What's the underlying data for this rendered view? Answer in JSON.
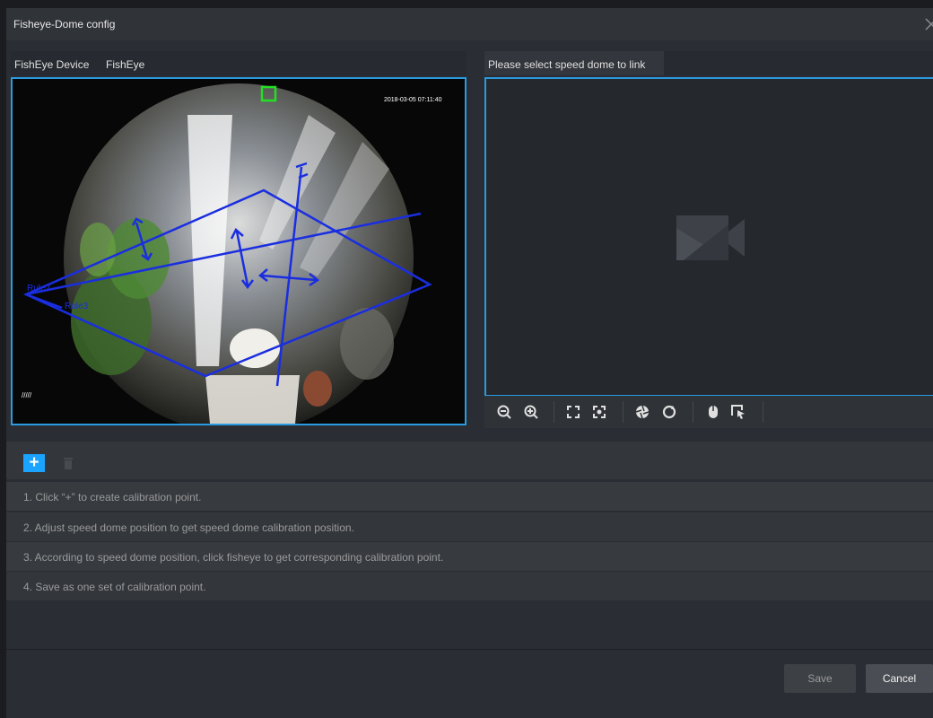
{
  "dialog": {
    "title": "Fisheye-Dome config"
  },
  "left_panel": {
    "device_label": "FishEye Device",
    "channel_label": "FishEye",
    "timestamp": "2018-03-05 07:11:40",
    "corner_text": "/////",
    "region_labels": [
      "Rule2",
      "Rule3"
    ]
  },
  "right_panel": {
    "tab_label": "Please select speed dome to link"
  },
  "toolbar": {
    "icons": [
      "zoom-out-icon",
      "zoom-in-icon",
      "fit-window-icon",
      "focus-icon",
      "iris-icon",
      "refresh-icon",
      "mouse-icon",
      "select-area-icon"
    ]
  },
  "calibration": {
    "add_label": "+",
    "steps": [
      "1. Click “+” to create calibration point.",
      "2. Adjust speed dome position to get speed dome calibration position.",
      "3. According to speed dome position, click fisheye to get corresponding calibration point.",
      "4. Save as one set of calibration point."
    ]
  },
  "footer": {
    "save_label": "Save",
    "cancel_label": "Cancel"
  },
  "colors": {
    "accent": "#1aa3ff",
    "border": "#2a9be0",
    "overlay": "#1a2ee0",
    "marker": "#22e022"
  }
}
